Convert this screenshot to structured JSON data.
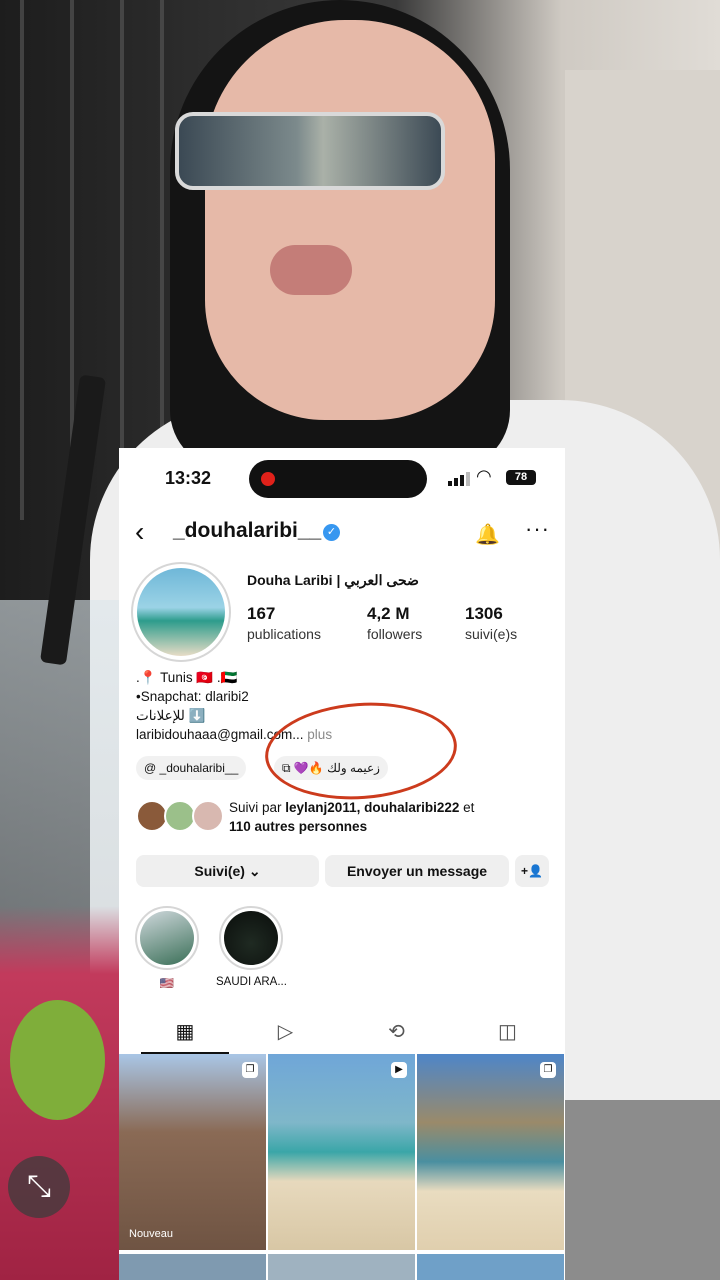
{
  "status": {
    "time": "13:32",
    "battery": "78"
  },
  "profile": {
    "username": "_douhalaribi__",
    "full_name": "Douha Laribi | ضحى العربي",
    "stats": [
      {
        "value": "167",
        "label": "publications"
      },
      {
        "value": "4,2 M",
        "label": "followers"
      },
      {
        "value": "1306",
        "label": "suivi(e)s"
      }
    ],
    "bio": {
      "line1": ".📍 Tunis 🇹🇳 .🇦🇪",
      "line2": "•Snapchat: dlaribi2",
      "line3": "للإعلانات ⬇️",
      "line4": "laribidouhaaa@gmail.com...",
      "more": " plus"
    },
    "chips": [
      {
        "label": "@ _douhalaribi__"
      },
      {
        "label": "⧉ 💜🔥 زعيمه ولك"
      }
    ],
    "followed_by": {
      "prefix": "Suivi par ",
      "names": "leylanj2011, douhalaribi222",
      "middle": " et",
      "others": "110 autres personnes"
    },
    "buttons": {
      "following": "Suivi(e) ⌄",
      "message": "Envoyer un message",
      "add": "+👤"
    },
    "highlights": [
      {
        "label": "🇺🇸"
      },
      {
        "label": "SAUDI ARA..."
      }
    ],
    "grid": {
      "first_tag": "Nouveau"
    }
  },
  "overlay": {
    "minimize_icon": "⤡"
  }
}
